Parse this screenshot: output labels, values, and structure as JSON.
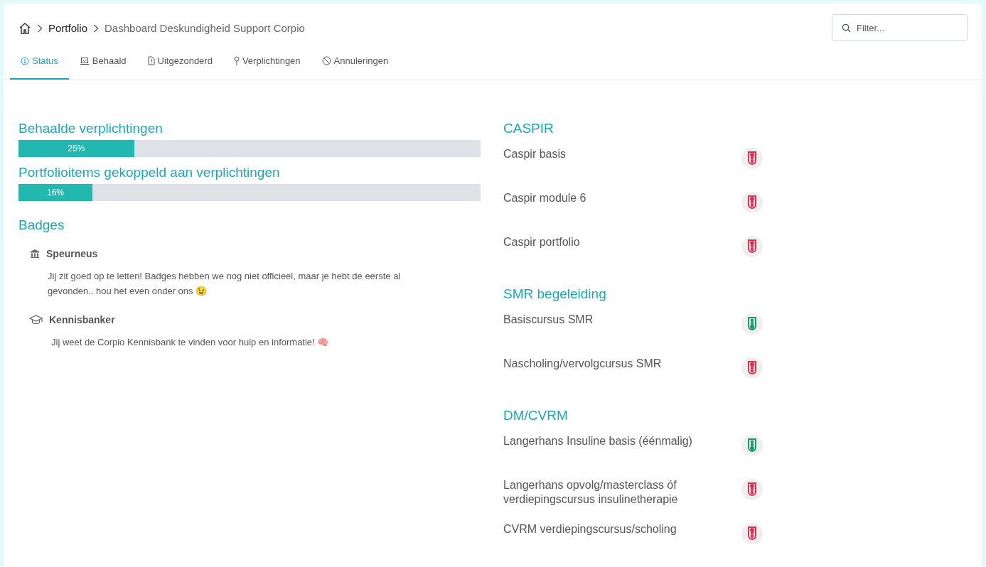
{
  "breadcrumb": {
    "items": [
      "Portfolio",
      "Dashboard Deskundigheid Support Corpio"
    ]
  },
  "filter": {
    "placeholder": "Filter..."
  },
  "tabs": [
    {
      "label": "Status",
      "selected": true
    },
    {
      "label": "Behaald",
      "selected": false
    },
    {
      "label": "Uitgezonderd",
      "selected": false
    },
    {
      "label": "Verplichtingen",
      "selected": false
    },
    {
      "label": "Annuleringen",
      "selected": false
    }
  ],
  "progress": [
    {
      "title": "Behaalde verplichtingen",
      "level": 0.25,
      "reading": "25%"
    },
    {
      "title": "Portfolioitems gekoppeld aan verplichtingen",
      "level": 0.16,
      "reading": "16%"
    }
  ],
  "badges": {
    "title": "Badges",
    "items": [
      {
        "name": "Speurneus",
        "text": "Jij zit goed op te letten! Badges hebben we nog niet officieel, maar je hebt de eerste al gevonden.. hou het even onder ons 😉"
      },
      {
        "name": "Kennisbanker",
        "text": "Jij weet de Corpio Kennisbank te vinden voor hulp en informatie! 🧠"
      }
    ]
  },
  "groups": [
    {
      "title": "CASPIR",
      "items": [
        {
          "name": "Caspir basis",
          "color": "#e0304f"
        },
        {
          "name": "Caspir module 6",
          "color": "#e0304f"
        },
        {
          "name": "Caspir portfolio",
          "color": "#e0304f"
        }
      ]
    },
    {
      "title": "SMR begeleiding",
      "items": [
        {
          "name": "Basiscursus SMR",
          "color": "#1a9a6c"
        },
        {
          "name": "Nascholing/vervolgcursus SMR",
          "color": "#e0304f"
        }
      ]
    },
    {
      "title": "DM/CVRM",
      "items": [
        {
          "name": "Langerhans Insuline basis (éénmalig)",
          "color": "#1a9a6c"
        },
        {
          "name": "Langerhans opvolg/masterclass óf verdiepingscursus insulinetherapie",
          "color": "#e0304f"
        },
        {
          "name": "CVRM verdiepingscursus/scholing",
          "color": "#e0304f"
        }
      ]
    }
  ]
}
